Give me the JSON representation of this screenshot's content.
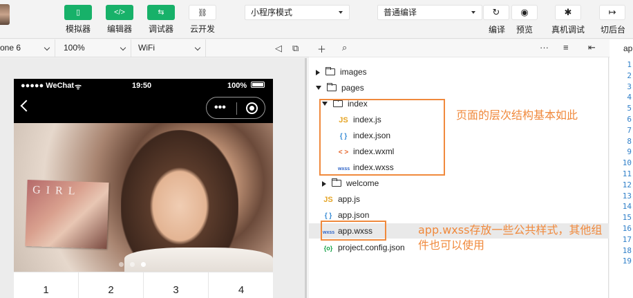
{
  "toolbar": {
    "simulator": "模拟器",
    "editor": "编辑器",
    "debugger": "调试器",
    "cloud": "云开发",
    "mode_select": "小程序模式",
    "compile_select": "普通编译",
    "compile": "编译",
    "preview": "预览",
    "device_debug": "真机调试",
    "background": "切后台"
  },
  "subbar": {
    "device": "one 6",
    "zoom": "100%",
    "network": "WiFi"
  },
  "phone": {
    "carrier": "●●●●● WeChat",
    "time": "19:50",
    "battery": "100%",
    "capsule_dots": "•••",
    "photo_text": "GIRL",
    "grid": [
      "1",
      "2",
      "3",
      "4"
    ]
  },
  "tree": {
    "items": [
      {
        "label": "images"
      },
      {
        "label": "pages"
      },
      {
        "label": "index"
      },
      {
        "label": "index.js",
        "icon": "JS"
      },
      {
        "label": "index.json",
        "icon": "{ }"
      },
      {
        "label": "index.wxml",
        "icon": "< >"
      },
      {
        "label": "index.wxss",
        "icon": "wxss"
      },
      {
        "label": "welcome"
      },
      {
        "label": "app.js",
        "icon": "JS"
      },
      {
        "label": "app.json",
        "icon": "{ }"
      },
      {
        "label": "app.wxss",
        "icon": "wxss"
      },
      {
        "label": "project.config.json",
        "icon": "{o}"
      }
    ]
  },
  "annotations": {
    "note1": "页面的层次结构基本如此",
    "note2_line1": "app.wxss存放一些公共样式，其他组",
    "note2_line2": "件也可以使用",
    "color": "#f0893c"
  },
  "editor": {
    "tab": "app",
    "lines": [
      "1",
      "2",
      "3",
      "4",
      "5",
      "6",
      "7",
      "8",
      "9",
      "10",
      "11",
      "12",
      "13",
      "14",
      "15",
      "16",
      "17",
      "18",
      "19"
    ]
  },
  "colors": {
    "accent": "#17b169"
  }
}
